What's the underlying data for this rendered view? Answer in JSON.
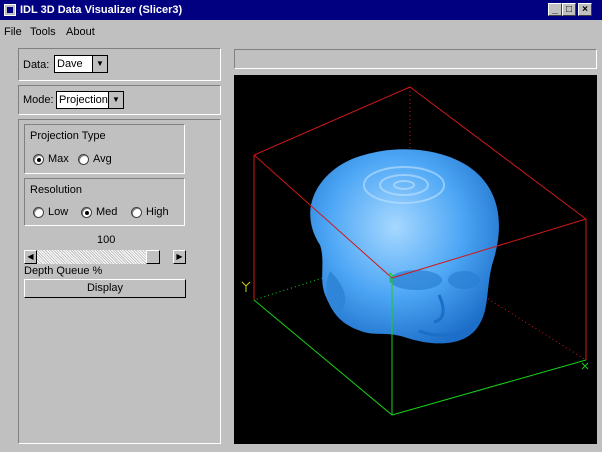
{
  "window": {
    "title": "IDL 3D Data Visualizer (Slicer3)"
  },
  "menu": {
    "items": [
      "File",
      "Tools",
      "About"
    ]
  },
  "data_select": {
    "label": "Data:",
    "value": "Dave"
  },
  "mode_select": {
    "label": "Mode:",
    "value": "Projection"
  },
  "projection": {
    "title": "Projection Type",
    "options": [
      "Max",
      "Avg"
    ],
    "selected": "Max"
  },
  "resolution": {
    "title": "Resolution",
    "options": [
      "Low",
      "Med",
      "High"
    ],
    "selected": "Med"
  },
  "depth": {
    "value_text": "100",
    "label": "Depth Queue %",
    "fraction": 1.0
  },
  "display_button": {
    "label": "Display"
  },
  "status_field": {
    "value": ""
  },
  "colors": {
    "title_bar": "#000080",
    "volume": "#4da6f5",
    "box_red": "#d01818",
    "box_green": "#18d018"
  },
  "icons": [
    "app-icon",
    "minimize-icon",
    "maximize-icon",
    "close-icon",
    "dropdown-arrow-icon",
    "scroll-left-icon",
    "scroll-right-icon"
  ]
}
